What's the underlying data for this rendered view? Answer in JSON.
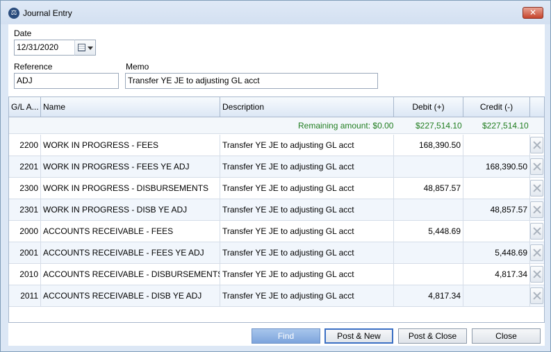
{
  "window": {
    "title": "Journal Entry",
    "close_label": "✕"
  },
  "form": {
    "date_label": "Date",
    "date_value": "12/31/2020",
    "reference_label": "Reference",
    "reference_value": "ADJ",
    "memo_label": "Memo",
    "memo_value": "Transfer YE JE to adjusting GL acct"
  },
  "grid": {
    "columns": {
      "gl_account": "G/L A...",
      "name": "Name",
      "description": "Description",
      "debit": "Debit (+)",
      "credit": "Credit (-)"
    },
    "summary": {
      "remaining": "Remaining amount: $0.00",
      "debit_total": "$227,514.10",
      "credit_total": "$227,514.10"
    },
    "rows": [
      {
        "gl": "2200",
        "name": "WORK IN PROGRESS - FEES",
        "description": "Transfer YE JE to adjusting GL acct",
        "debit": "168,390.50",
        "credit": ""
      },
      {
        "gl": "2201",
        "name": "WORK IN PROGRESS - FEES YE ADJ",
        "description": "Transfer YE JE to adjusting GL acct",
        "debit": "",
        "credit": "168,390.50"
      },
      {
        "gl": "2300",
        "name": "WORK IN PROGRESS - DISBURSEMENTS",
        "description": "Transfer YE JE to adjusting GL acct",
        "debit": "48,857.57",
        "credit": ""
      },
      {
        "gl": "2301",
        "name": "WORK IN PROGRESS - DISB YE ADJ",
        "description": "Transfer YE JE to adjusting GL acct",
        "debit": "",
        "credit": "48,857.57"
      },
      {
        "gl": "2000",
        "name": "ACCOUNTS RECEIVABLE - FEES",
        "description": "Transfer YE JE to adjusting GL acct",
        "debit": "5,448.69",
        "credit": ""
      },
      {
        "gl": "2001",
        "name": "ACCOUNTS RECEIVABLE - FEES YE ADJ",
        "description": "Transfer YE JE to adjusting GL acct",
        "debit": "",
        "credit": "5,448.69"
      },
      {
        "gl": "2010",
        "name": "ACCOUNTS RECEIVABLE - DISBURSEMENTS",
        "description": "Transfer YE JE to adjusting GL acct",
        "debit": "",
        "credit": "4,817.34"
      },
      {
        "gl": "2011",
        "name": "ACCOUNTS RECEIVABLE - DISB YE ADJ",
        "description": "Transfer YE JE to adjusting GL acct",
        "debit": "4,817.34",
        "credit": ""
      }
    ]
  },
  "buttons": {
    "find": "Find",
    "post_new": "Post & New",
    "post_close": "Post & Close",
    "close": "Close"
  },
  "colors": {
    "accent": "#7da4dc",
    "summary_text": "#1f7d1f",
    "close_button": "#c6442c"
  },
  "icons": {
    "app": "scales-icon",
    "calendar": "calendar-icon",
    "dropdown": "chevron-down-icon",
    "delete": "close-icon"
  }
}
